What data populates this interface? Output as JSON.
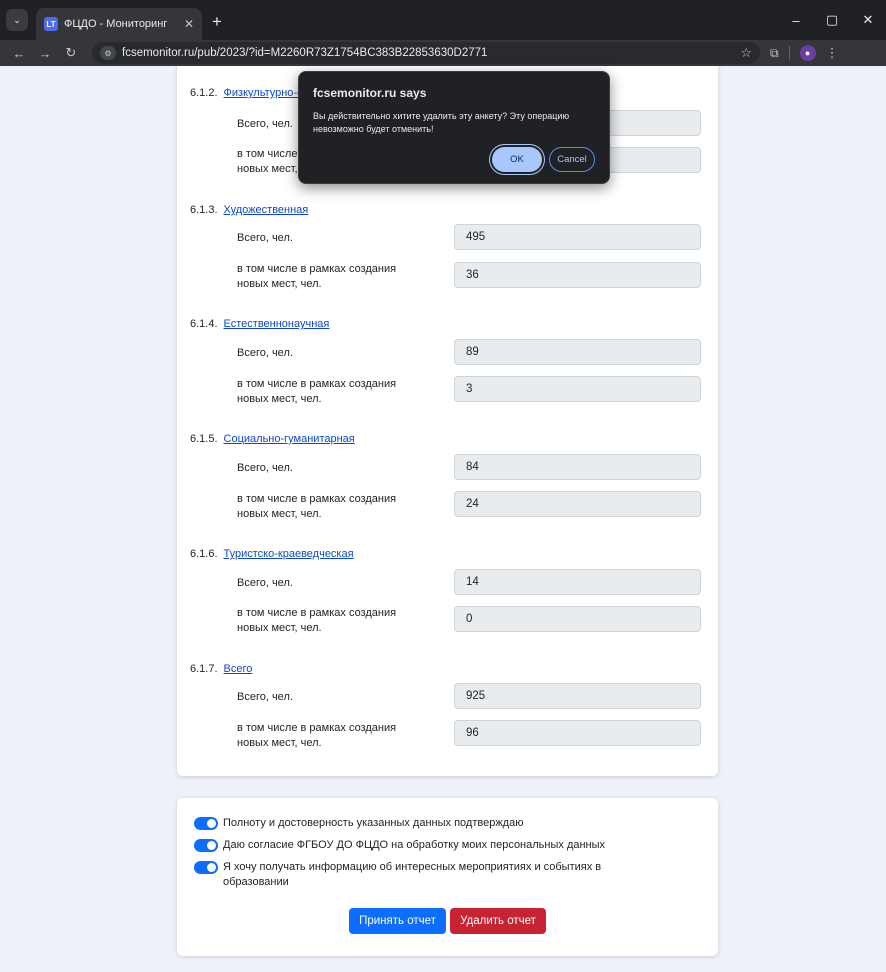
{
  "browser": {
    "tab_title": "ФЦДО - Мониторинг",
    "url_host": "fcsemonitor.ru",
    "url_path": "/pub/2023/?id=M2260R73Z1754BC383B22853630D2771"
  },
  "sections": [
    {
      "num": "6.1.2.",
      "title": "Физкультурно-спортивная",
      "total_label": "Всего, чел.",
      "total_value": "",
      "new_label": "в том числе в рамках создания новых мест, чел.",
      "new_value": ""
    },
    {
      "num": "6.1.3.",
      "title": "Художественная",
      "total_label": "Всего, чел.",
      "total_value": "495",
      "new_label": "в том числе в рамках создания новых мест, чел.",
      "new_value": "36"
    },
    {
      "num": "6.1.4.",
      "title": "Естественнонаучная",
      "total_label": "Всего, чел.",
      "total_value": "89",
      "new_label": "в том числе в рамках создания новых мест, чел.",
      "new_value": "3"
    },
    {
      "num": "6.1.5.",
      "title": "Социально-гуманитарная",
      "total_label": "Всего, чел.",
      "total_value": "84",
      "new_label": "в том числе в рамках создания новых мест, чел.",
      "new_value": "24"
    },
    {
      "num": "6.1.6.",
      "title": "Туристско-краеведческая",
      "total_label": "Всего, чел.",
      "total_value": "14",
      "new_label": "в том числе в рамках создания новых мест, чел.",
      "new_value": "0"
    },
    {
      "num": "6.1.7.",
      "title": "Всего",
      "total_label": "Всего, чел.",
      "total_value": "925",
      "new_label": "в том числе в рамках создания новых мест, чел.",
      "new_value": "96"
    }
  ],
  "checkboxes": [
    "Полноту и достоверность указанных данных подтверждаю",
    "Даю согласие ФГБОУ ДО ФЦДО на обработку моих персональных данных",
    "Я хочу получать информацию об интересных мероприятиях и событиях в образовании"
  ],
  "buttons": {
    "accept": "Принять отчет",
    "delete": "Удалить отчет"
  },
  "dialog": {
    "title": "fcsemonitor.ru says",
    "message": "Вы действительно хитите удалить эту анкету? Эту операцию невозможно будет отменить!",
    "ok": "OK",
    "cancel": "Cancel"
  }
}
